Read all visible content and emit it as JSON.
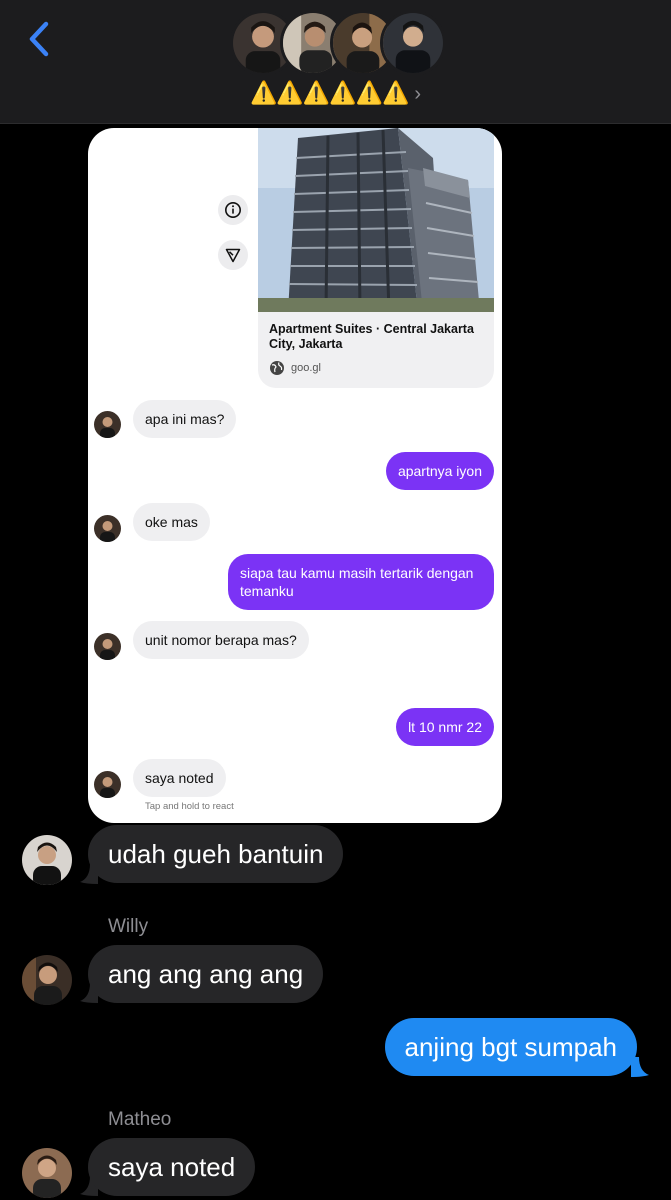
{
  "header": {
    "back_icon": "chevron-left-icon",
    "group_name": "⚠️⚠️⚠️⚠️⚠️⚠️",
    "chevron": "›",
    "accent": "#3b82f6"
  },
  "shared_screenshot": {
    "link_preview": {
      "title": "Apartment             Suites · Central Jakarta City, Jakarta",
      "url": "goo.gl"
    },
    "messages": [
      {
        "dir": "in",
        "text": "apa ini mas?"
      },
      {
        "dir": "out",
        "text": "apartnya iyon"
      },
      {
        "dir": "in",
        "text": "oke mas"
      },
      {
        "dir": "out",
        "text": "siapa tau kamu masih tertarik dengan temanku"
      },
      {
        "dir": "in",
        "text": "unit nomor berapa mas?"
      },
      {
        "dir": "out",
        "text": "lt 10 nmr 22"
      },
      {
        "dir": "in",
        "text": "saya noted"
      }
    ],
    "react_hint": "Tap and hold to react",
    "outgoing_color": "#7b33f5"
  },
  "thread": {
    "messages": [
      {
        "dir": "in",
        "sender": "",
        "text": "udah gueh bantuin"
      },
      {
        "dir": "in",
        "sender": "Willy",
        "text": "ang ang ang ang"
      },
      {
        "dir": "out",
        "sender": "",
        "text": "anjing bgt sumpah"
      },
      {
        "dir": "in",
        "sender": "Matheo",
        "text": "saya noted"
      }
    ],
    "outgoing_color": "#1f8af2",
    "incoming_color": "#262628"
  }
}
